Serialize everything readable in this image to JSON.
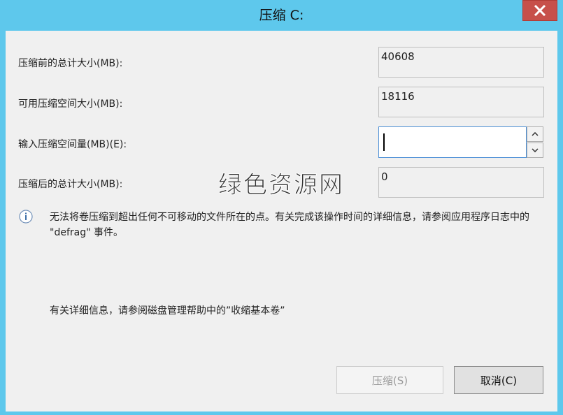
{
  "window": {
    "title": "压缩 C:",
    "close_icon": "close-icon"
  },
  "fields": {
    "total_before": {
      "label": "压缩前的总计大小(MB):",
      "value": "40608"
    },
    "available": {
      "label": "可用压缩空间大小(MB):",
      "value": "18116"
    },
    "enter_amount": {
      "label": "输入压缩空间量(MB)(E):",
      "value": ""
    },
    "total_after": {
      "label": "压缩后的总计大小(MB):",
      "value": "0"
    }
  },
  "info": {
    "icon": "info-icon",
    "text": "无法将卷压缩到超出任何不可移动的文件所在的点。有关完成该操作时间的详细信息，请参阅应用程序日志中的 \"defrag\" 事件。"
  },
  "help": {
    "text": "有关详细信息，请参阅磁盘管理帮助中的”收缩基本卷”"
  },
  "buttons": {
    "shrink": "压缩(S)",
    "cancel": "取消(C)"
  },
  "watermark": {
    "text": "绿色资源网"
  },
  "colors": {
    "titlebar": "#5ec8ec",
    "close_button": "#c7504a",
    "input_border": "#4d90d6"
  }
}
